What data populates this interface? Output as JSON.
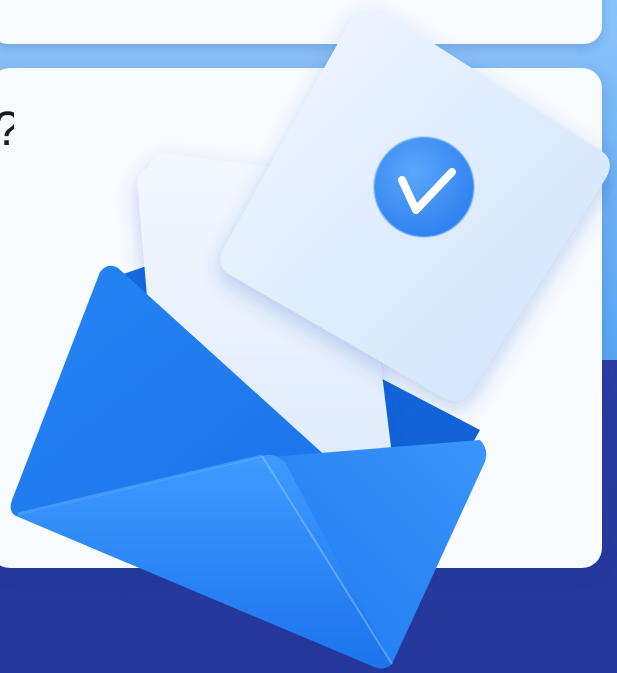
{
  "page": {
    "partial_text": "?"
  },
  "colors": {
    "top_background": "#7bb8f6",
    "bottom_background": "#2a3fa4",
    "card": "#f8fbff",
    "envelope_blue": "#1e7cf2",
    "envelope_light": "#4aa0ff",
    "letter_light": "#e6f1ff",
    "check_badge": "#3b8ff3"
  },
  "illustration": {
    "icons": [
      "envelope-icon",
      "letter-icon",
      "checkmark-icon"
    ]
  }
}
